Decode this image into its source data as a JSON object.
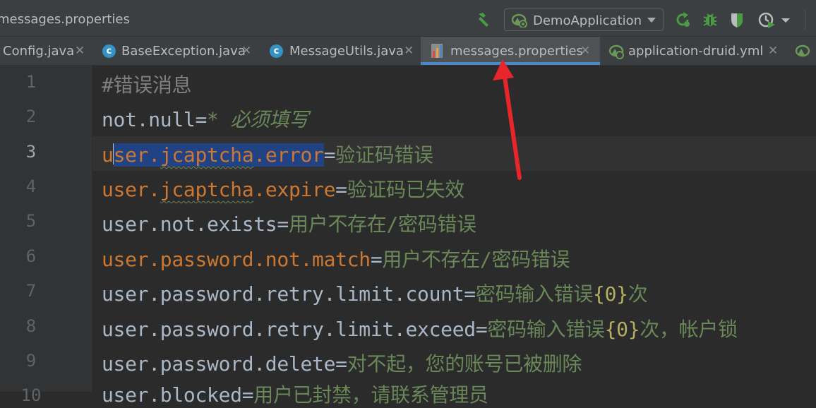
{
  "window": {
    "file_title": "messages.properties"
  },
  "toolbar": {
    "run_config_label": "DemoApplication",
    "icons": [
      "hammer-icon",
      "spring-run-config-icon",
      "rerun-icon",
      "debug-bug-icon",
      "coverage-shield-icon",
      "profiler-clock-icon",
      "more-dropdown-icon"
    ],
    "accent_green": "#4a9b43"
  },
  "tabs": [
    {
      "label": "Config.java",
      "icon": "none",
      "active": false
    },
    {
      "label": "BaseException.java",
      "icon": "class-c-icon",
      "active": false
    },
    {
      "label": "MessageUtils.java",
      "icon": "class-c-icon",
      "active": false
    },
    {
      "label": "messages.properties",
      "icon": "properties-file-icon",
      "active": true
    },
    {
      "label": "application-druid.yml",
      "icon": "spring-yml-icon",
      "active": false
    }
  ],
  "editor": {
    "line_numbers": [
      "1",
      "2",
      "3",
      "4",
      "5",
      "6",
      "7",
      "8",
      "9",
      "10"
    ],
    "current_line": "3",
    "lines": [
      {
        "comment": "#错误消息"
      },
      {
        "key": "not.null",
        "value": "* 必须填写"
      },
      {
        "key_pre": "u",
        "key_sel_a": "ser.",
        "key_sel_b": "jcaptcha",
        "key_sel_c": ".error",
        "value": "验证码错误"
      },
      {
        "key_a": "user.",
        "key_b": "jcaptcha",
        "key_c": ".expire",
        "value": "验证码已失效"
      },
      {
        "key": "user.not.exists",
        "value": "用户不存在/密码错误"
      },
      {
        "key": "user.password.not.match",
        "value": "用户不存在/密码错误"
      },
      {
        "key": "user.password.retry.limit.count",
        "value_a": "密码输入错误",
        "value_brace": "{0}",
        "value_b": "次"
      },
      {
        "key": "user.password.retry.limit.exceed",
        "value_a": "密码输入错误",
        "value_brace": "{0}",
        "value_b": "次，帐户锁"
      },
      {
        "key": "user.password.delete",
        "value": "对不起，您的账号已被删除"
      },
      {
        "key": "user.blocked",
        "value": "用户已封禁，请联系管理员"
      }
    ],
    "equals": "="
  },
  "annotation": {
    "color": "#e8262a",
    "target": "messages.properties tab"
  }
}
